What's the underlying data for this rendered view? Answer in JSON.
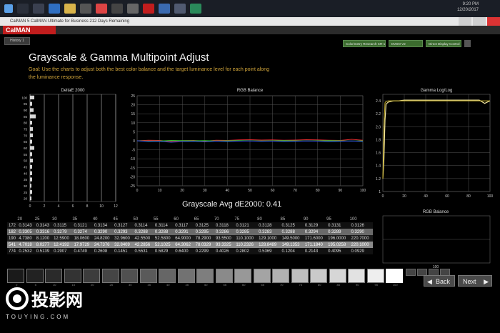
{
  "taskbar": {
    "time": "9:20 PM",
    "date": "12/20/2017"
  },
  "window": {
    "title": "CalMAN 5  CalMAN Ultimate for Business 212 Days Remaining"
  },
  "app": {
    "logo": "CalMAN"
  },
  "tabs": {
    "history": "History 1"
  },
  "devices": [
    {
      "label": "Colorimetry Research CR-100 (0037)"
    },
    {
      "label": "DVDO V2"
    },
    {
      "label": "Direct Display Control"
    }
  ],
  "page": {
    "title": "Grayscale &  Gamma Multipoint Adjust",
    "goal_line1": "Goal: Use the charts to adjust both the best color balance and the target luminance level for each point along",
    "goal_line2": "the luminance response."
  },
  "summary": {
    "text": "Grayscale Avg dE2000: 0.41"
  },
  "chart_data": [
    {
      "type": "bar",
      "title": "DeltaE 2000",
      "orientation": "horizontal",
      "categories": [
        "100",
        "95",
        "90",
        "85",
        "80",
        "75",
        "70",
        "65",
        "60",
        "55",
        "50",
        "45",
        "40",
        "35",
        "30",
        "25",
        "20"
      ],
      "values": [
        0.6,
        0.3,
        0.5,
        0.8,
        0.3,
        0.4,
        0.4,
        0.3,
        0.6,
        0.3,
        0.4,
        0.3,
        0.3,
        0.3,
        0.2,
        0.3,
        0.2
      ],
      "xticks": [
        "0",
        "2",
        "4",
        "6",
        "8",
        "10",
        "12"
      ],
      "xlim": [
        0,
        12
      ],
      "grid": true
    },
    {
      "type": "line",
      "title": "RGB Balance",
      "x": [
        0,
        5,
        10,
        15,
        20,
        25,
        30,
        35,
        40,
        45,
        50,
        55,
        60,
        65,
        70,
        75,
        80,
        85,
        90,
        95,
        100
      ],
      "series": [
        {
          "color": "#e03030",
          "values": [
            0,
            0.3,
            0.2,
            -0.4,
            0.1,
            0.2,
            -0.2,
            0.3,
            0.2,
            0.5,
            0.6,
            0.4,
            0.5,
            0.3,
            0.4,
            0.6,
            0.5,
            0.3,
            0.2,
            0.8,
            0.3
          ]
        },
        {
          "color": "#30c030",
          "values": [
            0,
            -0.2,
            -0.1,
            0.2,
            0.1,
            0,
            0.1,
            -0.1,
            0,
            0.1,
            0,
            -0.1,
            0,
            0.1,
            0,
            -0.1,
            0,
            0.1,
            0,
            -0.2,
            0
          ]
        },
        {
          "color": "#3050e8",
          "values": [
            0,
            -0.4,
            -0.3,
            -0.8,
            -0.5,
            -0.3,
            -0.6,
            -0.2,
            -0.4,
            -0.2,
            -0.1,
            -0.3,
            -0.2,
            -0.4,
            -0.3,
            -0.1,
            -0.2,
            -0.5,
            -0.3,
            -0.1,
            -0.4
          ]
        }
      ],
      "xticks": [
        "0",
        "10",
        "20",
        "30",
        "40",
        "50",
        "60",
        "70",
        "80",
        "90",
        "100"
      ],
      "yticks": [
        "25",
        "20",
        "15",
        "10",
        "5",
        "0",
        "-5",
        "-10",
        "-15",
        "-20",
        "-25"
      ],
      "xlim": [
        0,
        100
      ],
      "ylim": [
        -25,
        25
      ],
      "grid": true
    },
    {
      "type": "line",
      "title": "Gamma Log/Log",
      "x": [
        0,
        1,
        2,
        3,
        5,
        10,
        15,
        20,
        30,
        40,
        50,
        60,
        70,
        80,
        90,
        95,
        100
      ],
      "series": [
        {
          "color": "#f2e6a0",
          "values": [
            1.2,
            1.5,
            2.1,
            2.35,
            2.38,
            2.4,
            2.4,
            2.41,
            2.41,
            2.41,
            2.41,
            2.41,
            2.41,
            2.41,
            2.41,
            2.36,
            2.4
          ]
        },
        {
          "color": "#c8b028",
          "values": [
            1.2,
            2.0,
            2.37,
            2.39,
            2.4,
            2.4,
            2.4,
            2.4,
            2.4,
            2.4,
            2.4,
            2.4,
            2.4,
            2.4,
            2.4,
            2.4,
            2.4
          ]
        }
      ],
      "xticks": [
        "0",
        "20",
        "40",
        "60",
        "80",
        "100"
      ],
      "yticks": [
        "2.4",
        "2.2",
        "2.0",
        "1.8",
        "1.6",
        "1.4",
        "1.2",
        "1"
      ],
      "xlim": [
        0,
        100
      ],
      "ylim": [
        1,
        2.5
      ],
      "grid": true
    },
    {
      "type": "line",
      "title": "RGB Balance",
      "xticks": [
        "100"
      ],
      "series": []
    }
  ],
  "table": {
    "headers": [
      "20",
      "25",
      "30",
      "35",
      "40",
      "45",
      "50",
      "55",
      "60",
      "65",
      "70",
      "75",
      "80",
      "85",
      "90",
      "95",
      "100"
    ],
    "rows": [
      [
        "172",
        "0.3143",
        "0.3143",
        "0.3115",
        "0.3121",
        "0.3134",
        "0.3127",
        "0.3114",
        "0.3114",
        "0.3117",
        "0.3125",
        "0.3118",
        "0.3121",
        "0.3128",
        "0.3125",
        "0.3129",
        "0.3131",
        "0.3126"
      ],
      [
        "182",
        "0.3305",
        "0.3316",
        "0.3279",
        "0.3274",
        "0.3290",
        "0.3293",
        "0.3288",
        "0.3288",
        "0.3291",
        "0.3295",
        "0.3286",
        "0.3285",
        "0.3283",
        "0.3288",
        "0.3294",
        "0.3289",
        "0.3290"
      ],
      [
        "190",
        "4.7380",
        "8.1200",
        "12.5900",
        "18.0600",
        "24.8200",
        "32.9600",
        "42.5500",
        "52.5800",
        "64.9000",
        "78.2900",
        "93.5500",
        "110.1000",
        "129.1000",
        "149.5000",
        "171.6000",
        "196.0000",
        "220.7000"
      ],
      [
        "541",
        "4.7018",
        "8.0277",
        "12.4192",
        "17.9729",
        "24.7376",
        "32.8409",
        "42.2856",
        "52.1025",
        "64.3062",
        "78.0329",
        "93.3325",
        "110.2326",
        "128.8489",
        "149.1353",
        "171.1840",
        "195.0258",
        "220.1000"
      ],
      [
        "774",
        "0.2532",
        "0.5139",
        "0.2907",
        "0.4749",
        "0.2608",
        "0.1451",
        "0.5531",
        "0.5829",
        "0.6400",
        "0.2299",
        "0.4026",
        "0.2802",
        "0.5369",
        "0.1204",
        "0.2143",
        "0.4095",
        "0.0929"
      ]
    ]
  },
  "swatches": {
    "labels": [
      "0",
      "5",
      "10",
      "15",
      "20",
      "25",
      "30",
      "35",
      "40",
      "45",
      "50",
      "55",
      "60",
      "65",
      "70",
      "75",
      "80",
      "85",
      "90",
      "95",
      "100"
    ],
    "colors": [
      "#1a1a1a",
      "#222",
      "#2a2a2a",
      "#333",
      "#3c3c3c",
      "#454545",
      "#505050",
      "#5a5a5a",
      "#666",
      "#727272",
      "#7e7e7e",
      "#8a8a8a",
      "#989898",
      "#a4a4a4",
      "#b2b2b2",
      "#bebebe",
      "#cacaca",
      "#d6d6d6",
      "#e2e2e2",
      "#eeeeee",
      "#ffffff"
    ],
    "selected_label": "100"
  },
  "nav": {
    "back": "Back",
    "next": "Next"
  },
  "watermark": {
    "brand": "投影网",
    "domain": "TOUYING.COM"
  },
  "colors": {
    "accent_red": "#c11d1d",
    "goal_text": "#d0a43a",
    "device_green": "#3b6b2e"
  }
}
